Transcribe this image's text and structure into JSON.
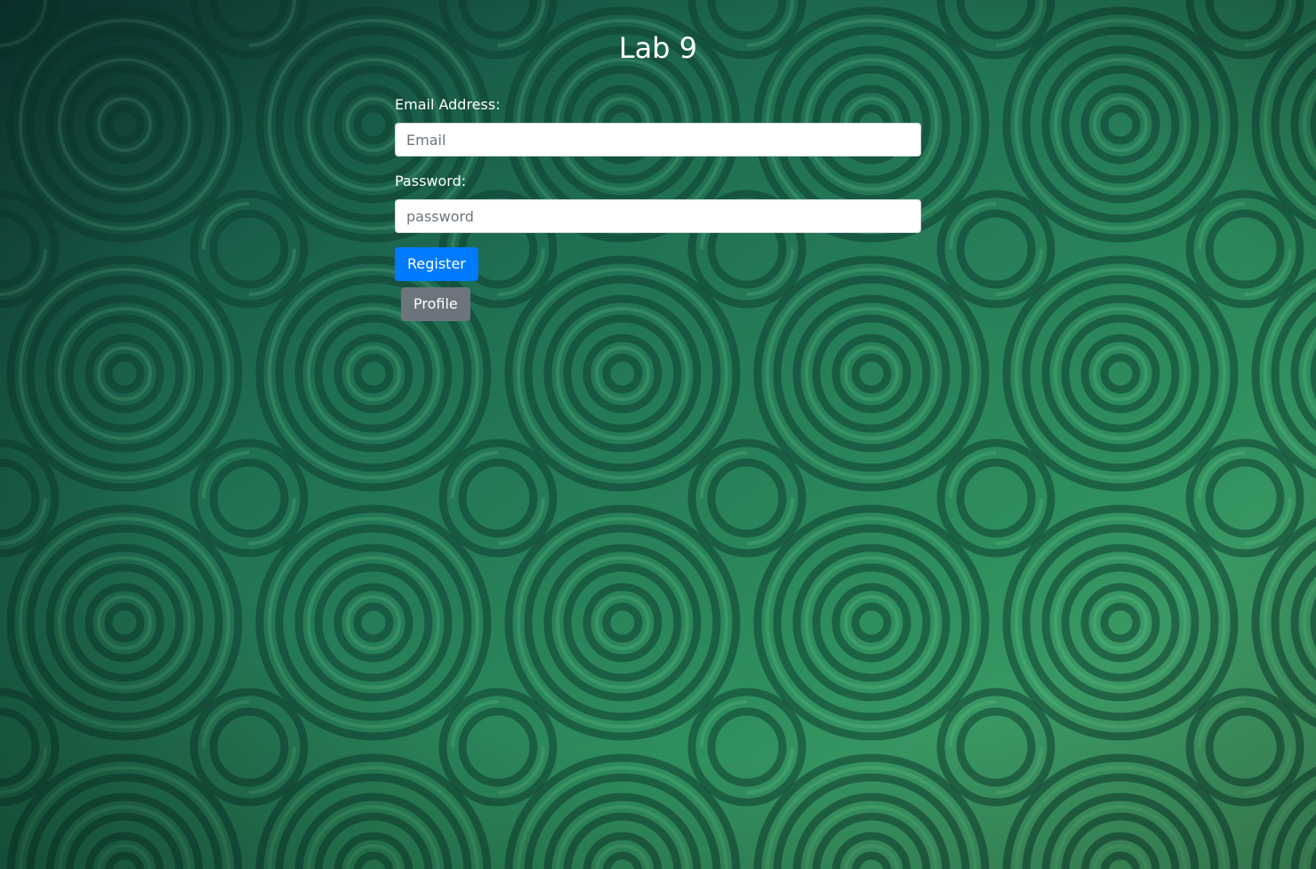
{
  "page": {
    "title": "Lab 9",
    "background_colors": {
      "dark": "#0f3f3a",
      "mid": "#1f7a55",
      "light": "#52b877"
    }
  },
  "form": {
    "email": {
      "label": "Email Address:",
      "placeholder": "Email",
      "value": ""
    },
    "password": {
      "label": "Password:",
      "placeholder": "password",
      "value": ""
    },
    "register_button": {
      "label": "Register",
      "color": "#007bff"
    },
    "profile_button": {
      "label": "Profile",
      "color": "#6c757d"
    }
  }
}
